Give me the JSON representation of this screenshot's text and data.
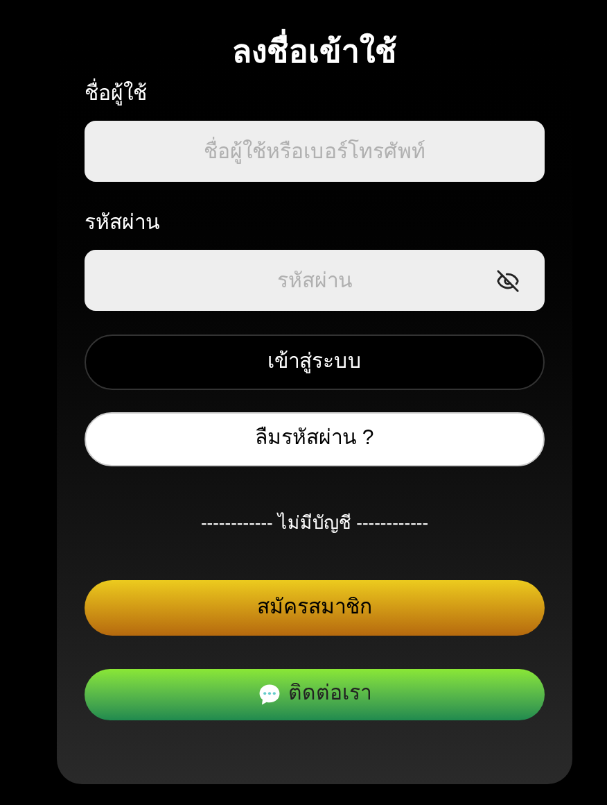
{
  "title": "ลงชื่อเข้าใช้",
  "fields": [
    {
      "label": "ชื่อผู้ใช้",
      "placeholder": "ชื่อผู้ใช้หรือเบอร์โทรศัพท์",
      "kind": "text"
    },
    {
      "label": "รหัสผ่าน",
      "placeholder": "รหัสผ่าน",
      "kind": "password"
    }
  ],
  "login_button": "เข้าสู่ระบบ",
  "forgot_button": "ลืมรหัสผ่าน ?",
  "divider": "------------ ไม่มีบัญชี ------------",
  "register_button": "สมัครสมาชิก",
  "contact_button": "ติดต่อเรา"
}
